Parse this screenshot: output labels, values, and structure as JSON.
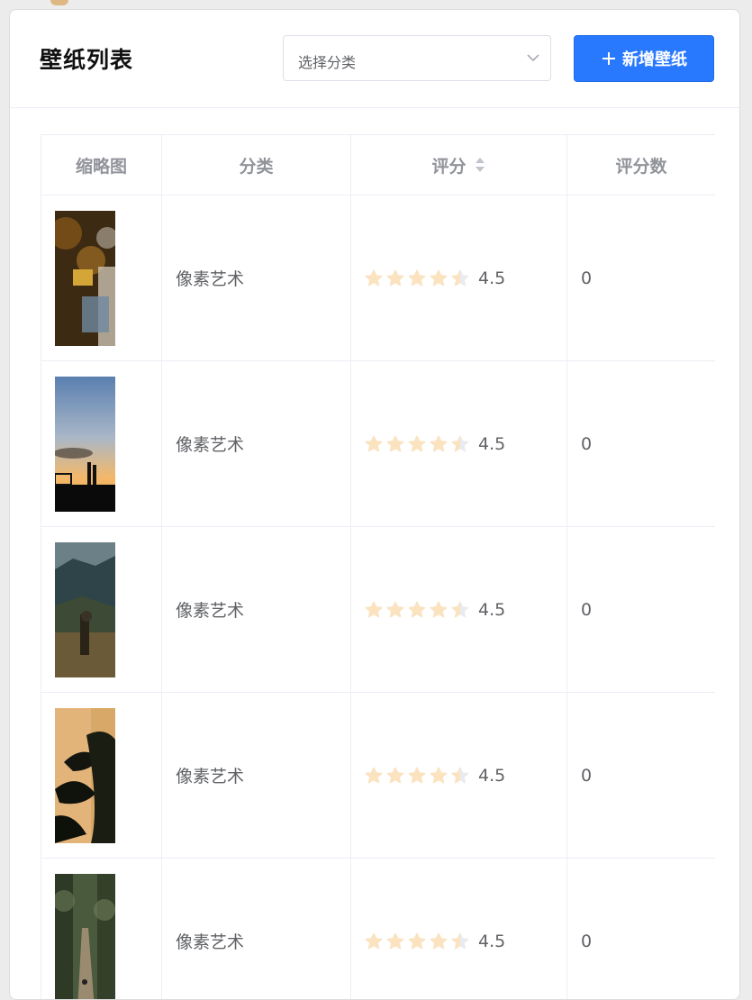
{
  "page": {
    "title": "壁纸列表"
  },
  "filter": {
    "placeholder": "选择分类"
  },
  "add_button": {
    "label": "新增壁纸"
  },
  "table": {
    "columns": [
      "缩略图",
      "分类",
      "评分",
      "评分数"
    ],
    "rows": [
      {
        "category": "像素艺术",
        "rating": "4.5",
        "rating_count": "0"
      },
      {
        "category": "像素艺术",
        "rating": "4.5",
        "rating_count": "0"
      },
      {
        "category": "像素艺术",
        "rating": "4.5",
        "rating_count": "0"
      },
      {
        "category": "像素艺术",
        "rating": "4.5",
        "rating_count": "0"
      },
      {
        "category": "像素艺术",
        "rating": "4.5",
        "rating_count": "0"
      }
    ]
  },
  "colors": {
    "primary": "#2979ff",
    "star_active": "#fbe3c0",
    "star_inactive": "#e8ebf0"
  }
}
